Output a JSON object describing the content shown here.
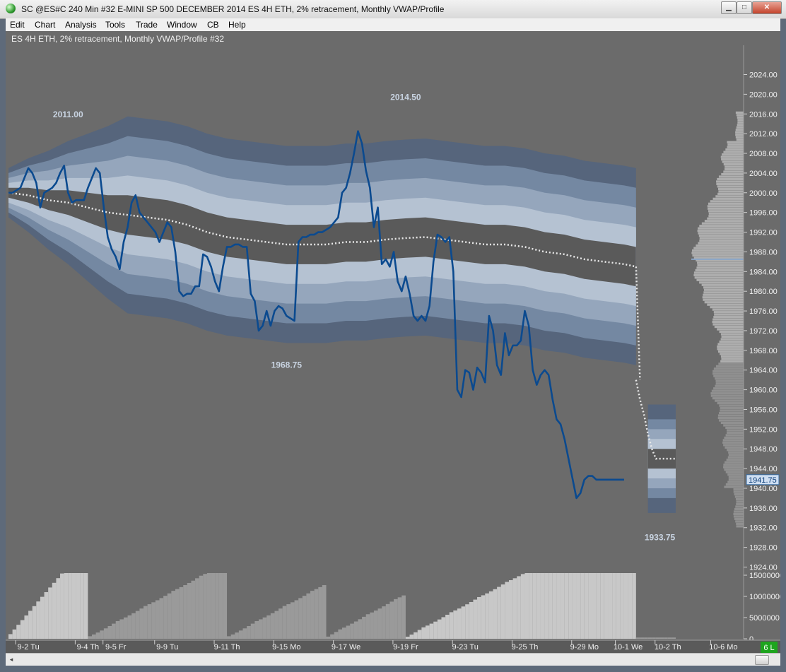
{
  "window": {
    "title": "SC @ES#C  240 Min   #32  E-MINI SP 500 DECEMBER 2014  ES 4H ETH, 2% retracement, Monthly VWAP/Profile",
    "min_glyph": "▁",
    "max_glyph": "□",
    "close_glyph": "✕"
  },
  "menu": [
    "Edit",
    "Chart",
    "Analysis",
    "Tools",
    "Trade",
    "Window",
    "CB",
    "Help"
  ],
  "chart_header": "ES 4H ETH, 2% retracement, Monthly VWAP/Profile #32",
  "scroll": {
    "left_glyph": "◂"
  },
  "chart_data": {
    "type": "line",
    "price_axis": {
      "min": 1920,
      "max": 2028,
      "ticks": [
        2024,
        2020,
        2016,
        2012,
        2008,
        2004,
        2000,
        1996,
        1992,
        1988,
        1984,
        1980,
        1976,
        1972,
        1968,
        1964,
        1960,
        1956,
        1952,
        1948,
        1944,
        1940,
        1936,
        1932,
        1928,
        1924
      ],
      "tick_labels": [
        "2024.00",
        "2020.00",
        "2016.00",
        "2012.00",
        "2008.00",
        "2004.00",
        "2000.00",
        "1996.00",
        "1992.00",
        "1988.00",
        "1984.00",
        "1980.00",
        "1976.00",
        "1972.00",
        "1968.00",
        "1964.00",
        "1960.00",
        "1956.00",
        "1952.00",
        "1948.00",
        "1944.00",
        "1940.00",
        "1936.00",
        "1932.00",
        "1928.00",
        "1924.00"
      ]
    },
    "current_price": "1941.75",
    "volume_axis": {
      "max": 16000000,
      "ticks": [
        15000000,
        10000000,
        5000000,
        0
      ],
      "tick_labels": [
        "15000000",
        "10000000",
        "5000000",
        "0"
      ]
    },
    "x_range": [
      0,
      160
    ],
    "x_ticks": [
      {
        "x": 5,
        "label": "9-2 Tu"
      },
      {
        "x": 20,
        "label": "9-4 Th"
      },
      {
        "x": 27,
        "label": "9-5 Fr"
      },
      {
        "x": 40,
        "label": "9-9 Tu"
      },
      {
        "x": 55,
        "label": "9-11 Th"
      },
      {
        "x": 70,
        "label": "9-15 Mo"
      },
      {
        "x": 85,
        "label": "9-17 We"
      },
      {
        "x": 100,
        "label": "9-19 Fr"
      },
      {
        "x": 115,
        "label": "9-23 Tu"
      },
      {
        "x": 130,
        "label": "9-25 Th"
      },
      {
        "x": 145,
        "label": "9-29 Mo"
      },
      {
        "x": 156,
        "label": "10-1 We"
      },
      {
        "x": 166,
        "label": "10-2 Th"
      },
      {
        "x": 180,
        "label": "10-6 Mo"
      }
    ],
    "status_badge": "6 L",
    "annotations": [
      {
        "x": 15,
        "price": 2011.0,
        "text": "2011.00"
      },
      {
        "x": 100,
        "price": 2014.5,
        "text": "2014.50"
      },
      {
        "x": 70,
        "price": 1968.75,
        "text": "1968.75"
      },
      {
        "x": 164,
        "price": 1933.75,
        "text": "1933.75"
      }
    ],
    "price_series": {
      "name": "",
      "x": [
        0,
        1,
        2,
        3,
        4,
        5,
        6,
        7,
        8,
        9,
        10,
        11,
        12,
        13,
        14,
        15,
        16,
        17,
        18,
        19,
        20,
        21,
        22,
        23,
        24,
        25,
        26,
        27,
        28,
        29,
        30,
        31,
        32,
        33,
        34,
        35,
        36,
        37,
        38,
        39,
        40,
        41,
        42,
        43,
        44,
        45,
        46,
        47,
        48,
        49,
        50,
        51,
        52,
        53,
        54,
        55,
        56,
        57,
        58,
        59,
        60,
        61,
        62,
        63,
        64,
        65,
        66,
        67,
        68,
        69,
        70,
        71,
        72,
        73,
        74,
        75,
        76,
        77,
        78,
        79,
        80,
        81,
        82,
        83,
        84,
        85,
        86,
        87,
        88,
        89,
        90,
        91,
        92,
        93,
        94,
        95,
        96,
        97,
        98,
        99,
        100,
        101,
        102,
        103,
        104,
        105,
        106,
        107,
        108,
        109,
        110,
        111,
        112,
        113,
        114,
        115,
        116,
        117,
        118,
        119,
        120,
        121,
        122,
        123,
        124,
        125,
        126,
        127,
        128,
        129,
        130,
        131,
        132,
        133,
        134,
        135,
        136,
        137,
        138,
        139,
        140,
        141,
        142,
        143,
        144,
        145,
        146,
        147,
        148,
        149,
        150,
        151,
        152,
        153,
        154,
        155,
        156,
        157,
        158,
        159,
        160,
        161,
        162,
        163,
        164,
        165,
        166,
        167,
        168
      ],
      "values": [
        2000,
        2000,
        2000.5,
        2001,
        2003,
        2005,
        2004,
        2002,
        1997,
        2000,
        2000.5,
        2001,
        2002,
        2004,
        2005.5,
        2000,
        1998,
        1998.5,
        1998.5,
        1998.5,
        2001,
        2003,
        2005,
        2004,
        1997,
        1991,
        1988.5,
        1987,
        1984.5,
        1990,
        1993,
        1998,
        1999.5,
        1996,
        1995,
        1994,
        1993,
        1992,
        1990,
        1992,
        1994,
        1993,
        1988,
        1980,
        1979,
        1979.5,
        1979.5,
        1981,
        1981,
        1987.5,
        1987,
        1985,
        1982,
        1980,
        1985,
        1989,
        1989,
        1989.5,
        1989.5,
        1989,
        1989,
        1979.5,
        1978,
        1972,
        1973,
        1976,
        1973,
        1976,
        1977,
        1976.5,
        1975,
        1974.5,
        1974,
        1990,
        1991,
        1991,
        1991.5,
        1991.5,
        1992,
        1992,
        1992.5,
        1993,
        1994,
        1995,
        2000,
        2001,
        2004,
        2008,
        2012.5,
        2010,
        2004.5,
        2001,
        1993,
        1997,
        1985.5,
        1986.5,
        1985,
        1988,
        1982,
        1980,
        1983,
        1979.5,
        1975,
        1974,
        1975,
        1974,
        1977,
        1986,
        1991.5,
        1991,
        1990,
        1991,
        1984,
        1960,
        1958.5,
        1964,
        1963.5,
        1960,
        1964.5,
        1963.5,
        1961.5,
        1975,
        1972,
        1965,
        1963,
        1971.5,
        1967,
        1969,
        1969,
        1970,
        1976,
        1973,
        1964,
        1961,
        1963,
        1964,
        1963,
        1958,
        1954,
        1953,
        1950,
        1946,
        1942,
        1938,
        1939,
        1941.75,
        1942.5,
        1942.5,
        1941.75,
        1941.75,
        1941.75,
        1941.75,
        1941.75,
        1941.75,
        1941.75,
        1941.75
      ]
    },
    "vwap_series": {
      "name": "",
      "segments": [
        {
          "x": [
            0,
            5,
            10,
            15,
            20,
            25,
            30,
            35,
            40,
            45,
            50,
            55,
            60,
            65,
            70,
            75,
            80,
            85,
            90,
            95,
            100,
            105,
            110,
            115,
            120,
            125,
            130,
            135,
            140,
            145,
            150,
            155,
            158
          ],
          "values": [
            2000,
            1999.5,
            1998.5,
            1998,
            1997,
            1996,
            1995.5,
            1995,
            1994.5,
            1993.5,
            1992,
            1991,
            1990.5,
            1990,
            1989.5,
            1989.5,
            1989.5,
            1990,
            1990,
            1990.5,
            1990.8,
            1991,
            1990.5,
            1990,
            1989.5,
            1989.5,
            1989,
            1988,
            1987.5,
            1986.5,
            1986,
            1985.5,
            1985
          ]
        },
        {
          "x": [
            158,
            159,
            160,
            161,
            162,
            163,
            164,
            165,
            166,
            167,
            168
          ],
          "values": [
            1962,
            1958,
            1955,
            1951,
            1948,
            1946,
            1946,
            1946,
            1946,
            1946,
            1946
          ]
        }
      ]
    },
    "volume_profile_poc": 1986.5
  }
}
